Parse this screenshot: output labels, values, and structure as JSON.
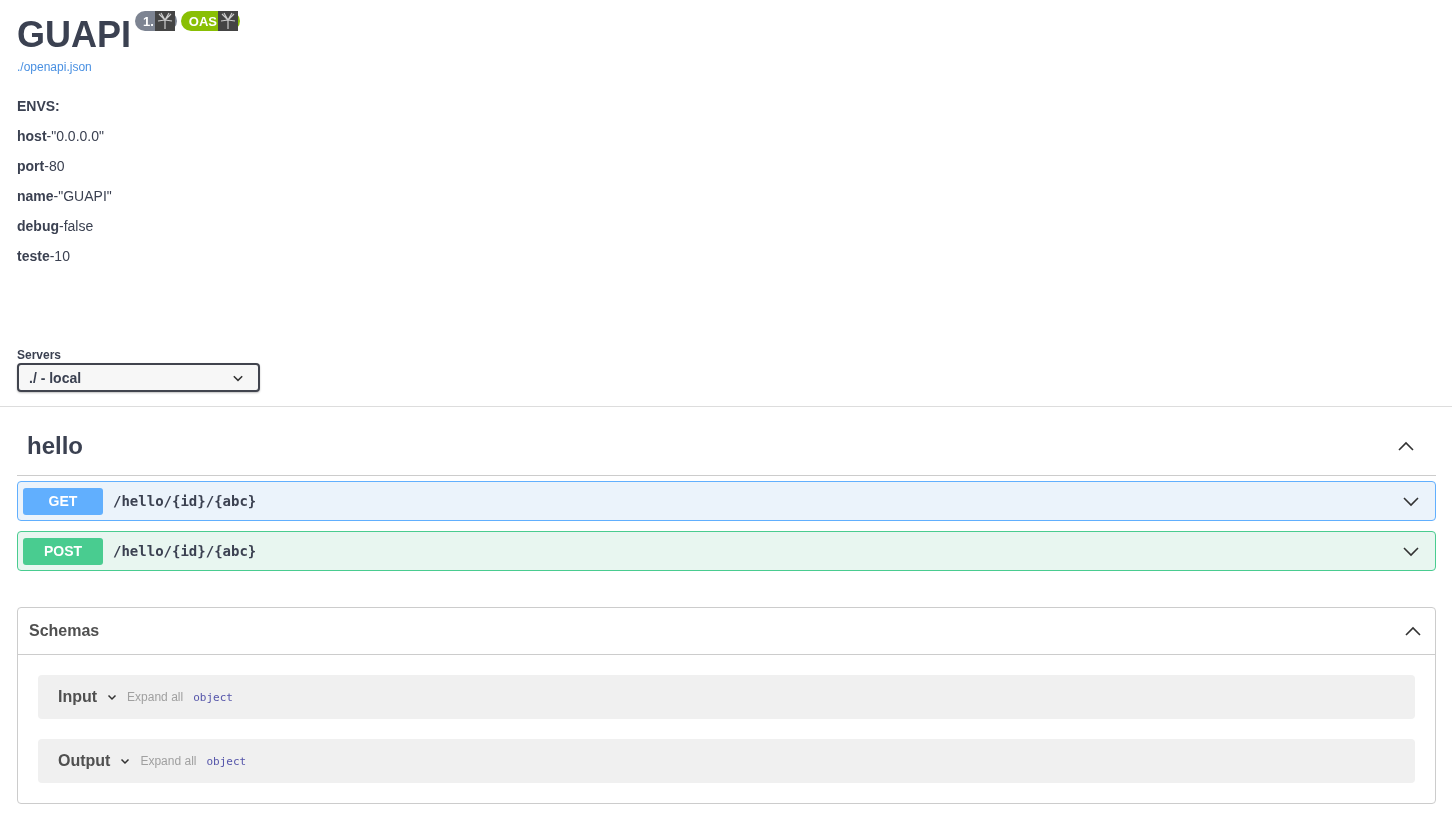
{
  "info": {
    "title": "GUAPI",
    "badges": [
      {
        "kind": "version",
        "label": "1."
      },
      {
        "kind": "oas",
        "label": "OAS"
      }
    ],
    "link": "./openapi.json",
    "envs_heading": "ENVS:",
    "envs": [
      {
        "key": "host",
        "value": "-\"0.0.0.0\""
      },
      {
        "key": "port",
        "value": "-80"
      },
      {
        "key": "name",
        "value": "-\"GUAPI\""
      },
      {
        "key": "debug",
        "value": "-false"
      },
      {
        "key": "teste",
        "value": "-10"
      }
    ]
  },
  "servers": {
    "label": "Servers",
    "value": "./ - local"
  },
  "tag": {
    "name": "hello",
    "expanded": true,
    "operations": [
      {
        "method": "GET",
        "path": "/hello/{id}/{abc}",
        "expanded": false
      },
      {
        "method": "POST",
        "path": "/hello/{id}/{abc}",
        "expanded": false
      }
    ]
  },
  "schemas": {
    "title": "Schemas",
    "expanded": true,
    "models": [
      {
        "name": "Input",
        "expand_all": "Expand all",
        "type": "object"
      },
      {
        "name": "Output",
        "expand_all": "Expand all",
        "type": "object"
      }
    ]
  }
}
